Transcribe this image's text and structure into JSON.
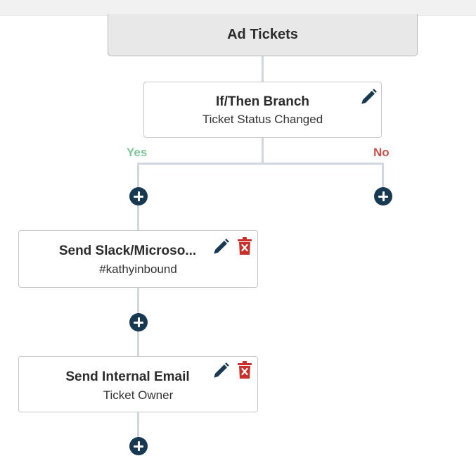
{
  "trigger": {
    "title": "Ad Tickets"
  },
  "branch": {
    "title": "If/Then Branch",
    "subtitle": "Ticket Status Changed",
    "yes_label": "Yes",
    "no_label": "No"
  },
  "actions": [
    {
      "title": "Send Slack/Microso...",
      "subtitle": "#kathyinbound"
    },
    {
      "title": "Send Internal Email",
      "subtitle": "Ticket Owner"
    }
  ],
  "colors": {
    "yes": "#7cc59a",
    "no": "#c9534b",
    "plus": "#173a52",
    "edit": "#173a52",
    "delete": "#c9302c",
    "connector": "#cfd7e1"
  },
  "icons": [
    "pencil-icon",
    "trash-icon",
    "plus-circle-icon"
  ]
}
